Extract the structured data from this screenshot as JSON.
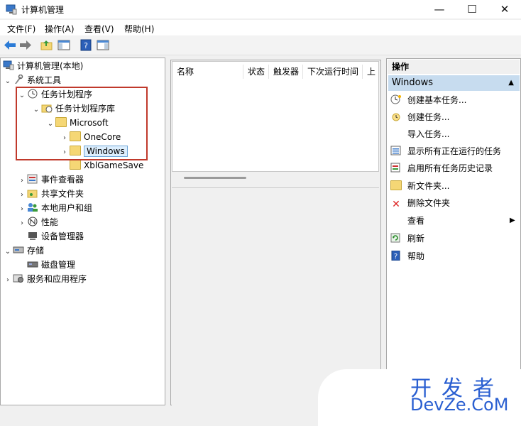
{
  "window": {
    "title": "计算机管理",
    "minimize": "—",
    "maximize": "☐",
    "close": "✕"
  },
  "menu": [
    "文件(F)",
    "操作(A)",
    "查看(V)",
    "帮助(H)"
  ],
  "tree": {
    "root": "计算机管理(本地)",
    "system_tools": "系统工具",
    "task_scheduler": "任务计划程序",
    "task_library": "任务计划程序库",
    "microsoft": "Microsoft",
    "onecore": "OneCore",
    "windows": "Windows",
    "xbl": "XblGameSave",
    "event_viewer": "事件查看器",
    "shared_folders": "共享文件夹",
    "local_users": "本地用户和组",
    "performance": "性能",
    "device_manager": "设备管理器",
    "storage": "存储",
    "disk_management": "磁盘管理",
    "services": "服务和应用程序"
  },
  "columns": [
    "名称",
    "状态",
    "触发器",
    "下次运行时间",
    "上次"
  ],
  "actions": {
    "header": "操作",
    "group": "Windows",
    "items": [
      "创建基本任务...",
      "创建任务...",
      "导入任务...",
      "显示所有正在运行的任务",
      "启用所有任务历史记录",
      "新文件夹...",
      "删除文件夹",
      "查看",
      "刷新",
      "帮助"
    ]
  },
  "watermark": {
    "cn": "开发者",
    "en": "DevZe.CoM"
  },
  "colors": {
    "highlight": "#c0392b",
    "selected_bar": "#c7dcef",
    "watermark": "#2a5fd1"
  }
}
